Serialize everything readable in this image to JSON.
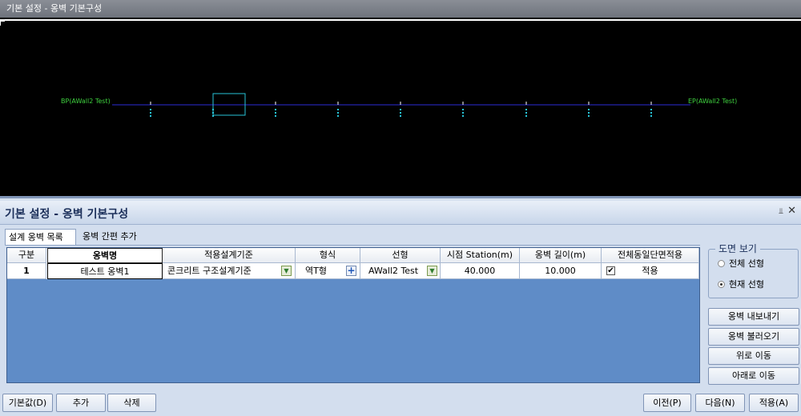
{
  "viewport": {
    "title": "기본 설정 - 옹벽 기본구성",
    "bp_start_label": "BP(AWall2 Test)",
    "bp_end_label": "EP(AWall2 Test)",
    "colors": {
      "background": "#000000",
      "alignment": "#2d2dd6",
      "station_marks": "#27c4d8",
      "labels": "#3fd23f"
    }
  },
  "panel": {
    "title": "기본 설정 - 옹벽 기본구성",
    "pin_icon": "pin-icon",
    "close_icon": "close-icon",
    "tabs": [
      {
        "label": "설계 옹벽 목록",
        "active": true
      },
      {
        "label": "옹벽 간편 추가",
        "active": false
      }
    ]
  },
  "grid": {
    "columns": [
      "구분",
      "옹벽명",
      "적용설계기준",
      "형식",
      "선형",
      "시점 Station(m)",
      "옹벽 길이(m)",
      "전체동일단면적용"
    ],
    "rows": [
      {
        "index": "1",
        "name": "테스트 옹벽1",
        "design_standard": "콘크리트 구조설계기준",
        "type": "역T형",
        "alignment": "AWall2 Test",
        "start_station": "40.000",
        "length": "10.000",
        "apply_same_section_checked": true,
        "apply_same_section_label": "적용"
      }
    ]
  },
  "view_group": {
    "legend": "도면 보기",
    "options": [
      {
        "label": "전체 선형",
        "selected": false
      },
      {
        "label": "현재 선형",
        "selected": true
      }
    ]
  },
  "side_buttons": [
    "옹벽 내보내기",
    "옹벽 불러오기",
    "위로 이동",
    "아래로 이동"
  ],
  "bottom_buttons": {
    "default": "기본값(D)",
    "add": "추가",
    "delete": "삭제",
    "prev": "이전(P)",
    "next": "다음(N)",
    "apply": "적용(A)"
  }
}
